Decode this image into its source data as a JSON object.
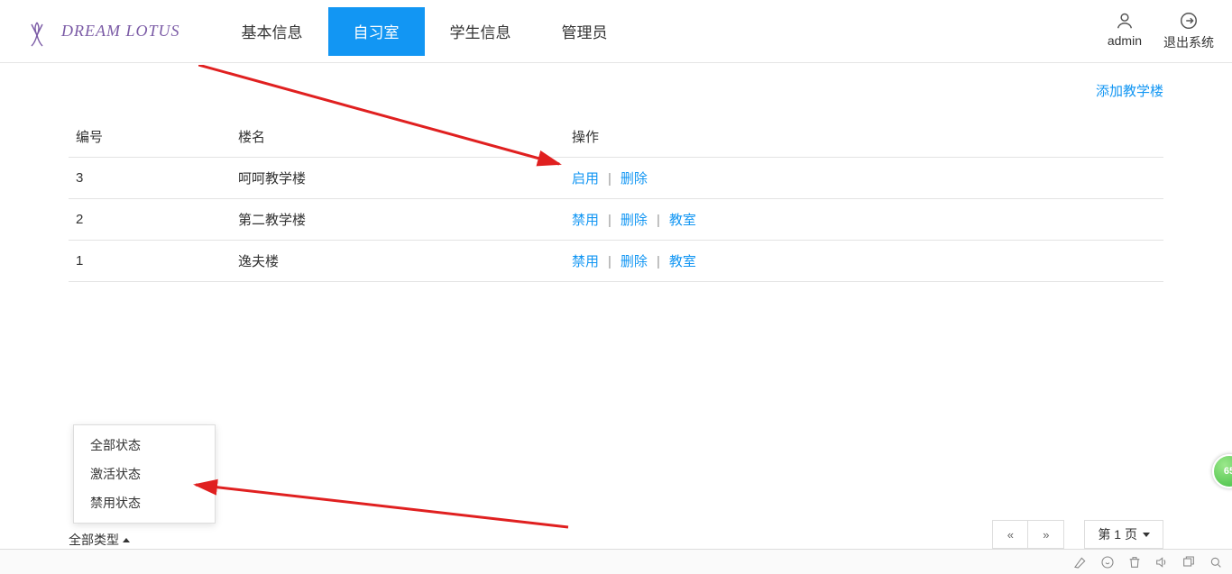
{
  "brand": {
    "text": "DREAM LOTUS"
  },
  "nav": {
    "items": [
      {
        "label": "基本信息",
        "active": false
      },
      {
        "label": "自习室",
        "active": true
      },
      {
        "label": "学生信息",
        "active": false
      },
      {
        "label": "管理员",
        "active": false
      }
    ]
  },
  "user": {
    "name": "admin",
    "logout": "退出系统"
  },
  "toolbar": {
    "add": "添加教学楼"
  },
  "table": {
    "headers": {
      "id": "编号",
      "name": "楼名",
      "actions": "操作"
    },
    "rows": [
      {
        "id": "3",
        "name": "呵呵教学楼",
        "actions": [
          "启用",
          "删除"
        ]
      },
      {
        "id": "2",
        "name": "第二教学楼",
        "actions": [
          "禁用",
          "删除",
          "教室"
        ]
      },
      {
        "id": "1",
        "name": "逸夫楼",
        "actions": [
          "禁用",
          "删除",
          "教室"
        ]
      }
    ]
  },
  "dropdown": {
    "items": [
      "全部状态",
      "激活状态",
      "禁用状态"
    ]
  },
  "typeSelector": {
    "label": "全部类型"
  },
  "pagination": {
    "prev": "«",
    "next": "»",
    "page_label": "第 1 页"
  },
  "badge": {
    "text": "65"
  }
}
